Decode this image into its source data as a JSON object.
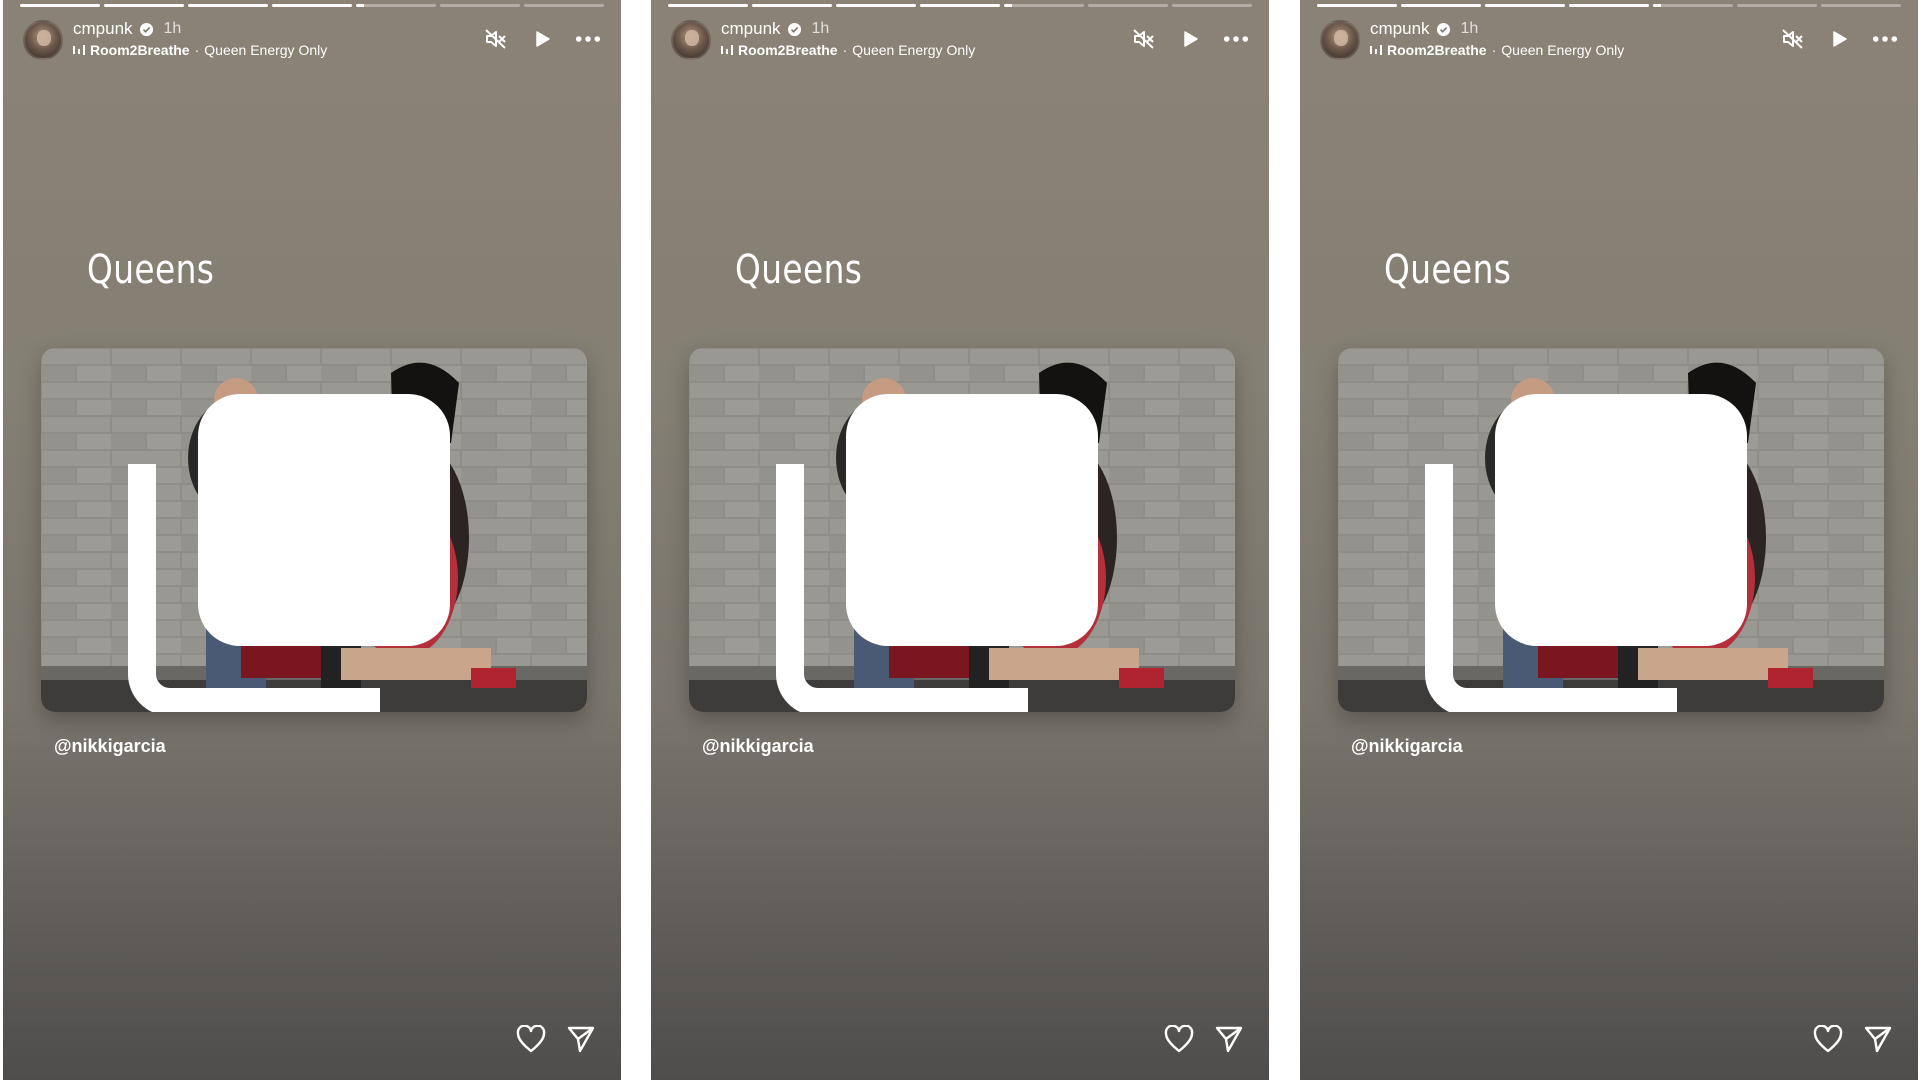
{
  "stories": [
    {
      "username": "cmpunk",
      "time": "1h",
      "song": "Room2Breathe",
      "artist": "Queen Energy Only",
      "caption": "Queens",
      "mention": "@nikkigarcia",
      "progress_segments": [
        1,
        1,
        1,
        1,
        0.1,
        0,
        0
      ]
    },
    {
      "username": "cmpunk",
      "time": "1h",
      "song": "Room2Breathe",
      "artist": "Queen Energy Only",
      "caption": "Queens",
      "mention": "@nikkigarcia",
      "progress_segments": [
        1,
        1,
        1,
        1,
        0.1,
        0,
        0
      ]
    },
    {
      "username": "cmpunk",
      "time": "1h",
      "song": "Room2Breathe",
      "artist": "Queen Energy Only",
      "caption": "Queens",
      "mention": "@nikkigarcia",
      "progress_segments": [
        1,
        1,
        1,
        1,
        0.1,
        0,
        0
      ]
    }
  ],
  "separator": "·",
  "icons": {
    "verified": "verified-badge-icon",
    "music": "music-bars-icon",
    "mute": "speaker-muted-icon",
    "play": "play-icon",
    "more": "more-dots-icon",
    "multi": "multiple-images-icon",
    "like": "heart-icon",
    "share": "paper-plane-icon"
  },
  "colors": {
    "background_top": "#8a8275",
    "background_bottom": "#4f4d4c",
    "text": "#ffffff"
  }
}
